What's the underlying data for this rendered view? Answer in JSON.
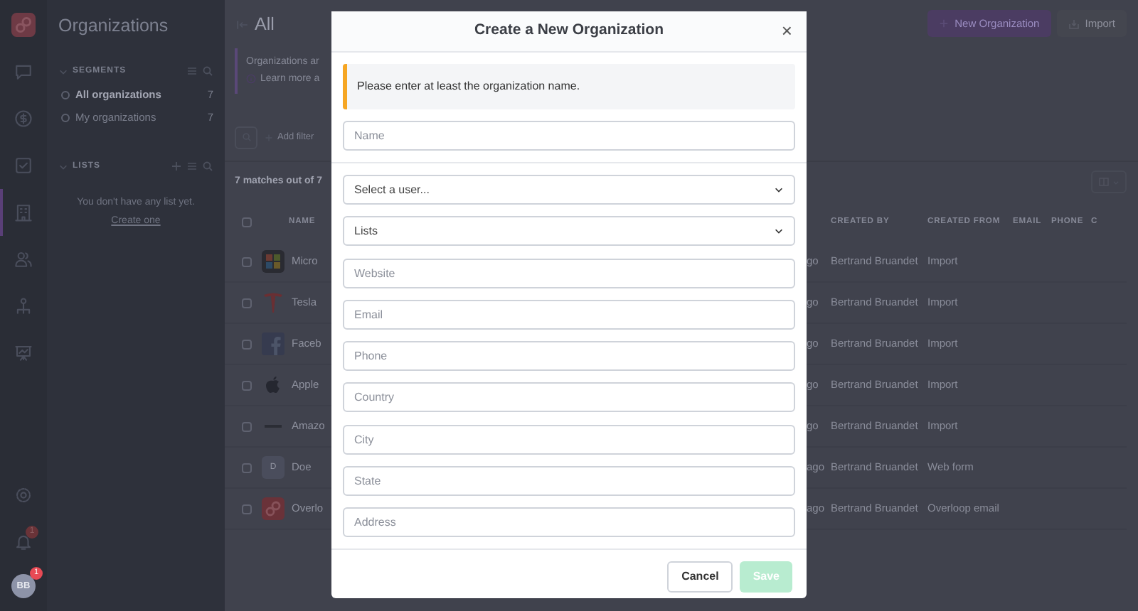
{
  "rail": {
    "items": [
      {
        "selected": false
      },
      {
        "selected": false
      },
      {
        "selected": false
      },
      {
        "selected": true
      },
      {
        "selected": false
      },
      {
        "selected": false
      },
      {
        "selected": false
      }
    ],
    "bell_badge": "1",
    "avatar": {
      "initials": "BB",
      "badge": "1"
    }
  },
  "sidebar": {
    "title": "Organizations",
    "segments": {
      "heading": "SEGMENTS",
      "items": [
        {
          "label": "All organizations",
          "count": "7",
          "selected": true
        },
        {
          "label": "My organizations",
          "count": "7",
          "selected": false
        }
      ]
    },
    "lists": {
      "heading": "LISTS",
      "empty_text": "You don't have any list yet.",
      "link": "Create one"
    }
  },
  "main": {
    "title": "All",
    "banner": {
      "text": "Organizations ar",
      "link": "Learn more a"
    },
    "add_filter": "Add filter",
    "matches": "7 matches out of 7",
    "new_button": "New Organization",
    "import_button": "Import",
    "table": {
      "left_columns": [
        "NAME"
      ],
      "right_columns": [
        "CREATED BY",
        "CREATED FROM",
        "EMAIL",
        "PHONE",
        "C"
      ],
      "select_all_checked": false,
      "rows": [
        {
          "checked": false,
          "name": "Micro",
          "column_2": "go",
          "created_by": "Bertrand Bruandet",
          "created_from": "Import"
        },
        {
          "checked": false,
          "name": "Tesla",
          "column_2": "go",
          "created_by": "Bertrand Bruandet",
          "created_from": "Import"
        },
        {
          "checked": false,
          "name": "Faceb",
          "column_2": "go",
          "created_by": "Bertrand Bruandet",
          "created_from": "Import"
        },
        {
          "checked": false,
          "name": "Apple",
          "column_2": "go",
          "created_by": "Bertrand Bruandet",
          "created_from": "Import"
        },
        {
          "checked": false,
          "name": "Amazo",
          "column_2": "go",
          "created_by": "Bertrand Bruandet",
          "created_from": "Import"
        },
        {
          "checked": false,
          "initial": "D",
          "name": "Doe",
          "column_2": "ago",
          "created_by": "Bertrand Bruandet",
          "created_from": "Web form"
        },
        {
          "checked": false,
          "name": "Overlo",
          "column_2": "ago",
          "created_by": "Bertrand Bruandet",
          "created_from": "Overloop email"
        }
      ]
    }
  },
  "modal": {
    "title": "Create a New Organization",
    "close": "×",
    "alert": "Please enter at least the organization name.",
    "name_field": {
      "placeholder": "Name"
    },
    "fields": [
      {
        "kind": "select",
        "value": "Select a user..."
      },
      {
        "kind": "select",
        "value": "Lists"
      },
      {
        "kind": "text",
        "placeholder": "Website"
      },
      {
        "kind": "text",
        "placeholder": "Email"
      },
      {
        "kind": "text",
        "placeholder": "Phone"
      },
      {
        "kind": "text",
        "placeholder": "Country"
      },
      {
        "kind": "text",
        "placeholder": "City"
      },
      {
        "kind": "text",
        "placeholder": "State"
      },
      {
        "kind": "text",
        "placeholder": "Address"
      }
    ],
    "cancel": "Cancel",
    "save": {
      "label": "Save",
      "disabled": true
    }
  }
}
